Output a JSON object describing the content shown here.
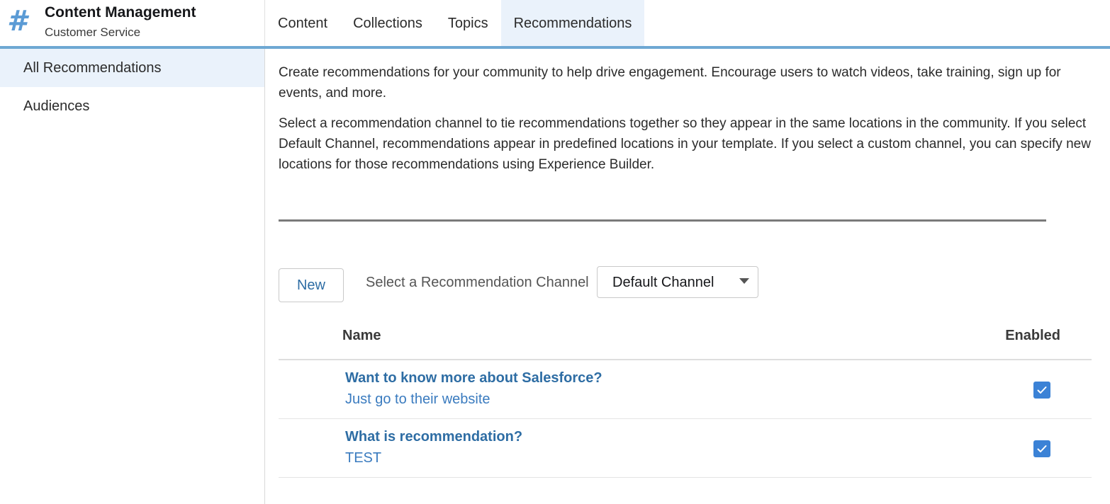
{
  "header": {
    "brand_icon": "hash-icon",
    "title": "Content Management",
    "subtitle": "Customer Service"
  },
  "tabs": [
    {
      "label": "Content",
      "active": false
    },
    {
      "label": "Collections",
      "active": false
    },
    {
      "label": "Topics",
      "active": false
    },
    {
      "label": "Recommendations",
      "active": true
    }
  ],
  "sidebar": {
    "items": [
      {
        "label": "All Recommendations",
        "active": true
      },
      {
        "label": "Audiences",
        "active": false
      }
    ]
  },
  "main": {
    "intro": "Create recommendations for your community to help drive engagement. Encourage users to watch videos, take training, sign up for events, and more.",
    "channel_help": "Select a recommendation channel to tie recommendations together so they appear in the same locations in the community. If you select Default Channel, recommendations appear in predefined locations in your template. If you select a custom channel, you can specify new locations for those recommendations using Experience Builder.",
    "new_button": "New",
    "channel_label": "Select a Recommendation Channel",
    "channel_selected": "Default Channel"
  },
  "table": {
    "columns": [
      "Name",
      "Enabled"
    ],
    "rows": [
      {
        "title": "Want to know more about Salesforce?",
        "subtitle": "Just go to their website",
        "enabled": true
      },
      {
        "title": "What is recommendation?",
        "subtitle": "TEST",
        "enabled": true
      }
    ]
  },
  "colors": {
    "accent": "#6ea8d3",
    "active_bg": "#eaf2fb",
    "link": "#2e6da4",
    "checkbox": "#3b82d6"
  }
}
